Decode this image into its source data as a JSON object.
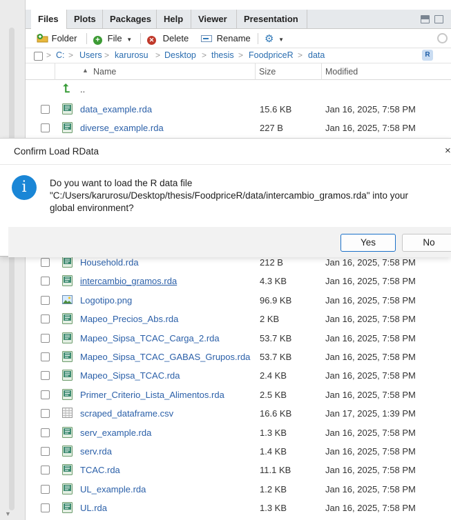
{
  "tabs": [
    {
      "label": "Files",
      "active": true
    },
    {
      "label": "Plots",
      "active": false
    },
    {
      "label": "Packages",
      "active": false
    },
    {
      "label": "Help",
      "active": false
    },
    {
      "label": "Viewer",
      "active": false
    },
    {
      "label": "Presentation",
      "active": false
    }
  ],
  "toolbar": {
    "folder_label": "Folder",
    "file_label": "File",
    "delete_label": "Delete",
    "rename_label": "Rename"
  },
  "breadcrumb": [
    "C:",
    "Users",
    "karurosu",
    "Desktop",
    "thesis",
    "FoodpriceR",
    "data"
  ],
  "columns": {
    "name": "Name",
    "size": "Size",
    "modified": "Modified"
  },
  "parent_label": "..",
  "files_top": [
    {
      "name": "data_example.rda",
      "size": "15.6 KB",
      "modified": "Jan 16, 2025, 7:58 PM",
      "icon": "rdata-icon"
    },
    {
      "name": "diverse_example.rda",
      "size": "227 B",
      "modified": "Jan 16, 2025, 7:58 PM",
      "icon": "rdata-icon"
    }
  ],
  "files_bottom": [
    {
      "name": "Household.rda",
      "size": "212 B",
      "modified": "Jan 16, 2025, 7:58 PM",
      "icon": "rdata-icon"
    },
    {
      "name": "intercambio_gramos.rda",
      "size": "4.3 KB",
      "modified": "Jan 16, 2025, 7:58 PM",
      "icon": "rdata-icon",
      "underlined": true
    },
    {
      "name": "Logotipo.png",
      "size": "96.9 KB",
      "modified": "Jan 16, 2025, 7:58 PM",
      "icon": "image-icon"
    },
    {
      "name": "Mapeo_Precios_Abs.rda",
      "size": "2 KB",
      "modified": "Jan 16, 2025, 7:58 PM",
      "icon": "rdata-icon"
    },
    {
      "name": "Mapeo_Sipsa_TCAC_Carga_2.rda",
      "size": "53.7 KB",
      "modified": "Jan 16, 2025, 7:58 PM",
      "icon": "rdata-icon"
    },
    {
      "name": "Mapeo_Sipsa_TCAC_GABAS_Grupos.rda",
      "size": "53.7 KB",
      "modified": "Jan 16, 2025, 7:58 PM",
      "icon": "rdata-icon"
    },
    {
      "name": "Mapeo_Sipsa_TCAC.rda",
      "size": "2.4 KB",
      "modified": "Jan 16, 2025, 7:58 PM",
      "icon": "rdata-icon"
    },
    {
      "name": "Primer_Criterio_Lista_Alimentos.rda",
      "size": "2.5 KB",
      "modified": "Jan 16, 2025, 7:58 PM",
      "icon": "rdata-icon"
    },
    {
      "name": "scraped_dataframe.csv",
      "size": "16.6 KB",
      "modified": "Jan 17, 2025, 1:39 PM",
      "icon": "csv-icon"
    },
    {
      "name": "serv_example.rda",
      "size": "1.3 KB",
      "modified": "Jan 16, 2025, 7:58 PM",
      "icon": "rdata-icon"
    },
    {
      "name": "serv.rda",
      "size": "1.4 KB",
      "modified": "Jan 16, 2025, 7:58 PM",
      "icon": "rdata-icon"
    },
    {
      "name": "TCAC.rda",
      "size": "11.1 KB",
      "modified": "Jan 16, 2025, 7:58 PM",
      "icon": "rdata-icon"
    },
    {
      "name": "UL_example.rda",
      "size": "1.2 KB",
      "modified": "Jan 16, 2025, 7:58 PM",
      "icon": "rdata-icon"
    },
    {
      "name": "UL.rda",
      "size": "1.3 KB",
      "modified": "Jan 16, 2025, 7:58 PM",
      "icon": "rdata-icon"
    }
  ],
  "dialog": {
    "title": "Confirm Load RData",
    "message_line1": "Do you want to load the R data file",
    "message_line2": "\"C:/Users/karurosu/Desktop/thesis/FoodpriceR/data/intercambio_gramos.rda\" into your",
    "message_line3": "global environment?",
    "yes_label": "Yes",
    "no_label": "No"
  },
  "colors": {
    "link": "#2a5fa8",
    "accent": "#1a70c8",
    "info": "#1a86d6"
  }
}
